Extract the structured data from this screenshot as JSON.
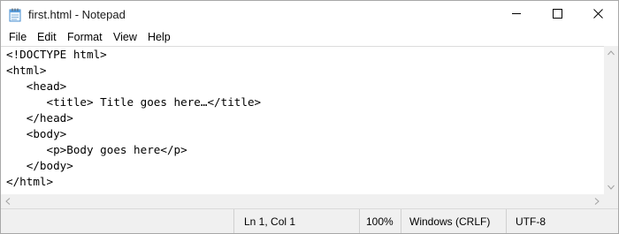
{
  "window": {
    "title": "first.html - Notepad",
    "icon": "notepad-icon",
    "controls": [
      "minimize-icon",
      "maximize-icon",
      "close-icon"
    ]
  },
  "menu": [
    "File",
    "Edit",
    "Format",
    "View",
    "Help"
  ],
  "editor": {
    "lines": [
      "<!DOCTYPE html>",
      "<html>",
      "   <head>",
      "      <title> Title goes here…</title>",
      "   </head>",
      "   <body>",
      "      <p>Body goes here</p>",
      "   </body>",
      "</html>"
    ]
  },
  "status": {
    "position": "Ln 1, Col 1",
    "zoom": "100%",
    "line_ending": "Windows (CRLF)",
    "encoding": "UTF-8"
  },
  "colors": {
    "chrome_bg": "#f0f0f0",
    "text": "#000000",
    "border": "#a8a8a8"
  }
}
